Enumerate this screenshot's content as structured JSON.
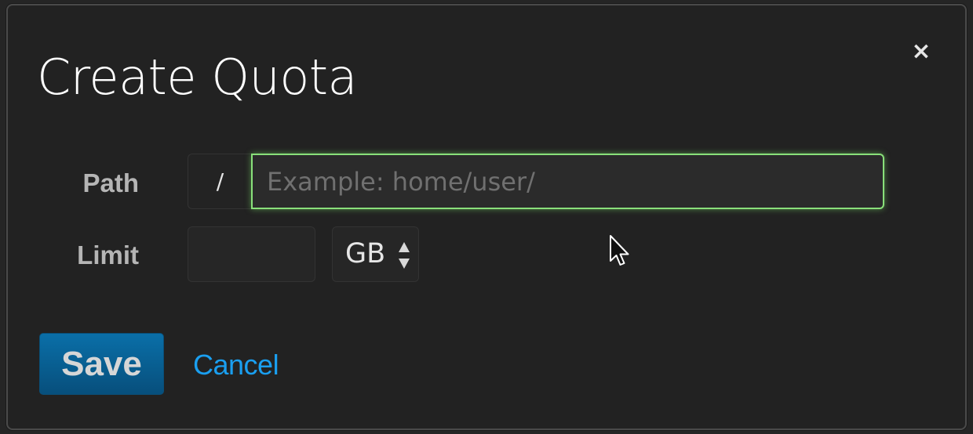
{
  "dialog": {
    "title": "Create Quota",
    "close_symbol": "×",
    "close_icon": "close-icon"
  },
  "form": {
    "path": {
      "label": "Path",
      "prefix": "/",
      "value": "",
      "placeholder": "Example: home/user/",
      "focus_color": "#89e07a"
    },
    "limit": {
      "label": "Limit",
      "value": "",
      "unit": "GB",
      "unit_icon": "updown-arrows-icon"
    }
  },
  "actions": {
    "save_label": "Save",
    "cancel_label": "Cancel",
    "save_color": "#0a6fa8",
    "cancel_color": "#1a9ff0"
  },
  "cursor": {
    "icon": "mouse-pointer-icon"
  }
}
